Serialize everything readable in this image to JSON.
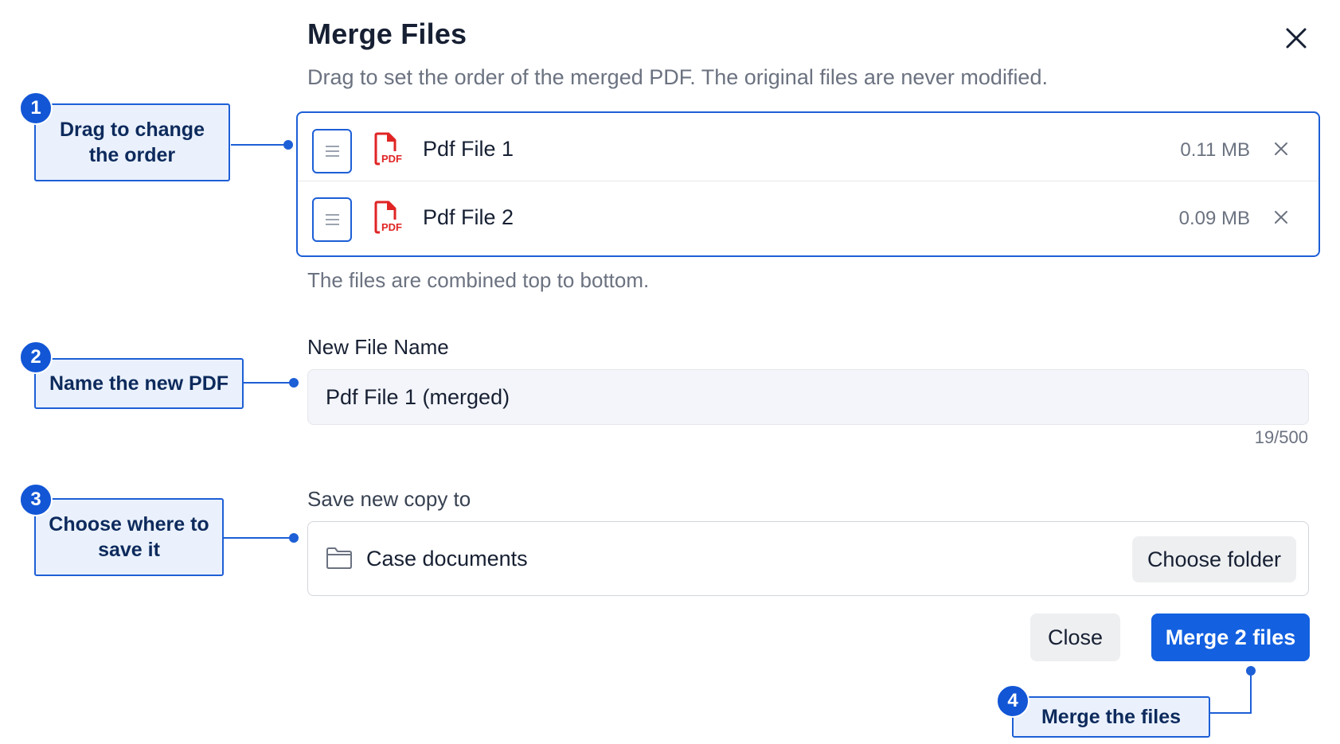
{
  "dialog": {
    "title": "Merge Files",
    "subtitle": "Drag to set the order of the merged PDF. The original files are never modified."
  },
  "files": [
    {
      "name": "Pdf File 1",
      "size": "0.11 MB",
      "icon": "pdf-file-icon"
    },
    {
      "name": "Pdf File 2",
      "size": "0.09 MB",
      "icon": "pdf-file-icon"
    }
  ],
  "files_hint": "The files are combined top to bottom.",
  "new_file_name": {
    "label": "New File Name",
    "value": "Pdf File 1 (merged)",
    "counter": "19/500"
  },
  "save_location": {
    "label": "Save new copy to",
    "folder": "Case documents",
    "choose_label": "Choose folder"
  },
  "actions": {
    "close_label": "Close",
    "merge_label": "Merge 2 files"
  },
  "callouts": [
    {
      "number": "1",
      "text": "Drag to change the order"
    },
    {
      "number": "2",
      "text": "Name the new PDF"
    },
    {
      "number": "3",
      "text": "Choose where to save it"
    },
    {
      "number": "4",
      "text": "Merge the files"
    }
  ],
  "colors": {
    "accent": "#1360e0",
    "callout_bg": "#eaf1fd",
    "pdf_red": "#e02424"
  }
}
